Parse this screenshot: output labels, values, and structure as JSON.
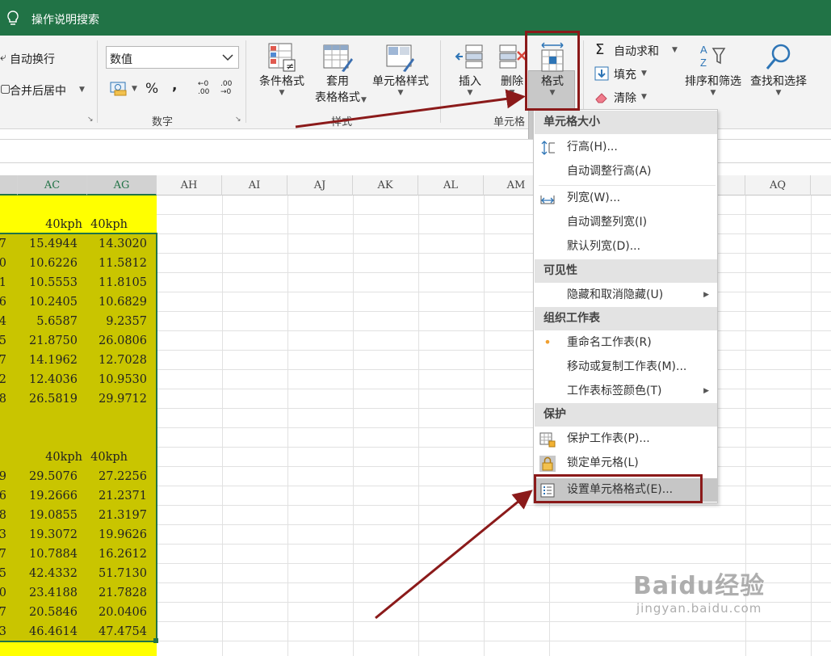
{
  "title_bar": {
    "tell_me": "操作说明搜索"
  },
  "ribbon": {
    "alignment": {
      "wrap_text": "自动换行",
      "merge_center": "合并后居中"
    },
    "number": {
      "format_value": "数值",
      "percent": "%",
      "comma": ",",
      "inc_decimal": "←0 .00",
      "dec_decimal": ".00 →0",
      "group_label": "数字"
    },
    "styles": {
      "conditional": "条件格式",
      "table_line1": "套用",
      "table_line2": "表格格式",
      "cell_styles": "单元格样式",
      "group_label": "样式"
    },
    "cells": {
      "insert": "插入",
      "delete": "删除",
      "format": "格式",
      "group_label": "单元格"
    },
    "editing": {
      "autosum": "自动求和",
      "fill": "填充",
      "clear": "清除",
      "sort_filter": "排序和筛选",
      "find_select": "查找和选择"
    }
  },
  "sheet": {
    "columns": [
      "AC",
      "AG",
      "AH",
      "AI",
      "AJ",
      "AK",
      "AL",
      "AM",
      "AQ"
    ],
    "header_row_1": {
      "AC": "40kph",
      "AG": "40kph"
    },
    "block1": [
      {
        "pre": "7",
        "ac": "15.4944",
        "ag": "14.3020"
      },
      {
        "pre": "0",
        "ac": "10.6226",
        "ag": "11.5812"
      },
      {
        "pre": "1",
        "ac": "10.5553",
        "ag": "11.8105"
      },
      {
        "pre": "6",
        "ac": "10.2405",
        "ag": "10.6829"
      },
      {
        "pre": "4",
        "ac": "5.6587",
        "ag": "9.2357"
      },
      {
        "pre": "5",
        "ac": "21.8750",
        "ag": "26.0806"
      },
      {
        "pre": "7",
        "ac": "14.1962",
        "ag": "12.7028"
      },
      {
        "pre": "2",
        "ac": "12.4036",
        "ag": "10.9530"
      },
      {
        "pre": "8",
        "ac": "26.5819",
        "ag": "29.9712"
      }
    ],
    "header_row_2": {
      "AC": "40kph",
      "AG": "40kph"
    },
    "block2": [
      {
        "pre": "9",
        "ac": "29.5076",
        "ag": "27.2256"
      },
      {
        "pre": "6",
        "ac": "19.2666",
        "ag": "21.2371"
      },
      {
        "pre": "8",
        "ac": "19.0855",
        "ag": "21.3197"
      },
      {
        "pre": "3",
        "ac": "19.3072",
        "ag": "19.9626"
      },
      {
        "pre": "7",
        "ac": "10.7884",
        "ag": "16.2612"
      },
      {
        "pre": "5",
        "ac": "42.4332",
        "ag": "51.7130"
      },
      {
        "pre": "0",
        "ac": "23.4188",
        "ag": "21.7828"
      },
      {
        "pre": "7",
        "ac": "20.5846",
        "ag": "20.0406"
      },
      {
        "pre": "3",
        "ac": "46.4614",
        "ag": "47.4754"
      }
    ]
  },
  "format_menu": {
    "sec_cell_size": "单元格大小",
    "row_height": "行高(H)...",
    "autofit_row": "自动调整行高(A)",
    "col_width": "列宽(W)...",
    "autofit_col": "自动调整列宽(I)",
    "default_width": "默认列宽(D)...",
    "sec_visibility": "可见性",
    "hide_unhide": "隐藏和取消隐藏(U)",
    "sec_organize": "组织工作表",
    "rename": "重命名工作表(R)",
    "move_copy": "移动或复制工作表(M)...",
    "tab_color": "工作表标签颜色(T)",
    "sec_protect": "保护",
    "protect_sheet": "保护工作表(P)...",
    "lock_cell": "锁定单元格(L)",
    "format_cells": "设置单元格格式(E)..."
  },
  "watermark": {
    "brand": "Baidu经验",
    "url": "jingyan.baidu.com"
  },
  "colors": {
    "excel_green": "#217346",
    "highlight_yellow": "#ffff00",
    "selection_olive": "#c9c500",
    "annotation_red": "#8b1a1a"
  }
}
